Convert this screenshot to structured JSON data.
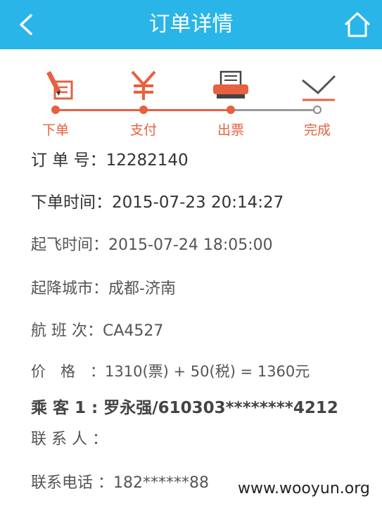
{
  "header": {
    "title": "订单详情"
  },
  "steps": [
    {
      "label": "下单",
      "icon": "order-pen-icon"
    },
    {
      "label": "支付",
      "icon": "yen-icon"
    },
    {
      "label": "出票",
      "icon": "printer-icon"
    },
    {
      "label": "完成",
      "icon": "check-icon"
    }
  ],
  "details": {
    "order_no_label": "订 单 号：",
    "order_no": "12282140",
    "order_time_label": "下单时间：",
    "order_time": "2015-07-23 20:14:27",
    "depart_time_label": "起飞时间：",
    "depart_time": "2015-07-24 18:05:00",
    "route_label": "起降城市：",
    "route": "成都-济南",
    "flight_label": "航 班 次：",
    "flight": "CA4527",
    "price_label": "价　格　：",
    "price": "1310(票) + 50(税) = 1360元",
    "passenger_label": "乘 客 1 : ",
    "passenger": "罗永强/610303********4212",
    "contact_label": "联 系 人 ：",
    "contact": "",
    "phone_label": "联系电话 ：",
    "phone": "182******88"
  },
  "watermark": "www.wooyun.org",
  "colors": {
    "header": "#29b5e8",
    "accent": "#e7603f",
    "pending": "#888888"
  }
}
